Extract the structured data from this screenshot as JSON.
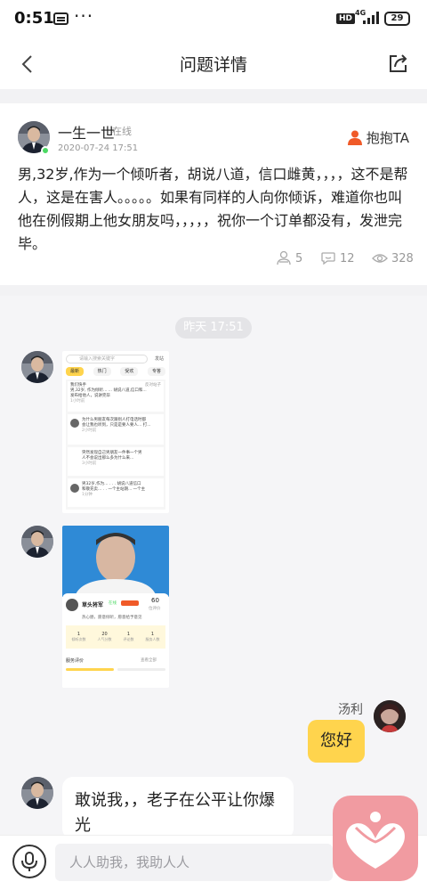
{
  "status_bar": {
    "time": "0:51",
    "dots": "···",
    "hd_label": "HD",
    "network": "4G",
    "battery": "29"
  },
  "nav": {
    "title": "问题详情"
  },
  "post": {
    "author_name": "一生一世",
    "author_status": "在线",
    "date": "2020-07-24 17:51",
    "hug_label": "抱抱TA",
    "text": "男,32岁,作为一个倾听者，胡说八道，信口雌黄，，，，这不是帮人，这是在害人。。。。。如果有同样的人向你倾诉，难道你也叫他在例假期上他女朋友吗，，，，，祝你一个订单都没有，发泄完毕。",
    "stats": {
      "hugs": "5",
      "comments": "12",
      "views": "328"
    }
  },
  "chat": {
    "time_divider": "昨天 17:51",
    "screenshot1": {
      "search_placeholder": "请输入搜索关键字",
      "search_btn": "发站",
      "tabs": [
        "最新",
        "热门",
        "受欢",
        "专答"
      ],
      "rows": [
        {
          "name": "我们快手",
          "tag": "反对站子",
          "line1": "男,32岁, 作为倾听...    ...   胡说八道,信口和...",
          "line2": "发布给他人，说讲完毕",
          "meta": "1小时前"
        },
        {
          "name": "",
          "tag": "",
          "line1": "为什么男朋友每次跟别人打电话时都",
          "line2": "会让我也听到，只是是要人要人... 打...",
          "meta": "2小时前"
        },
        {
          "name": "",
          "tag": "",
          "line1": "突然发现自己男朋友一件事一个男",
          "line2": "人不会说出那么多为什么来...",
          "meta": "3小时前"
        },
        {
          "name": "",
          "tag": "",
          "line1": "男32岁,作为... . . . 胡说八道信口",
          "line2": "和敬充卖... . . 一个主站期... 一个主",
          "meta": "1分钟"
        }
      ]
    },
    "screenshot2": {
      "name": "草头将军",
      "badge": "在线",
      "stars": "60",
      "stars_label": "位评价",
      "desc": "热心肠，愿意倾听，愿意给予意见",
      "stats": [
        {
          "value": "1",
          "label": "倾听次数"
        },
        {
          "value": "20",
          "label": "人气分数"
        },
        {
          "value": "1",
          "label": "评论数"
        },
        {
          "value": "1",
          "label": "服务人数"
        }
      ],
      "section_title": "服务评价",
      "section_more": "查看全部"
    },
    "right_name": "汤利",
    "right_text": "您好",
    "left_text": "敢说我，，老子在公平让你爆光"
  },
  "input": {
    "placeholder": "人人助我，我助人人"
  },
  "colors": {
    "accent_orange": "#f05a28",
    "bubble_yellow": "#ffd44d",
    "fab_pink": "#f19ba1",
    "online_green": "#4cd964"
  },
  "icons": {
    "back": "chevron-left-icon",
    "share": "share-icon",
    "hug": "person-hug-icon",
    "mic": "microphone-icon",
    "fab": "heart-hug-icon"
  }
}
